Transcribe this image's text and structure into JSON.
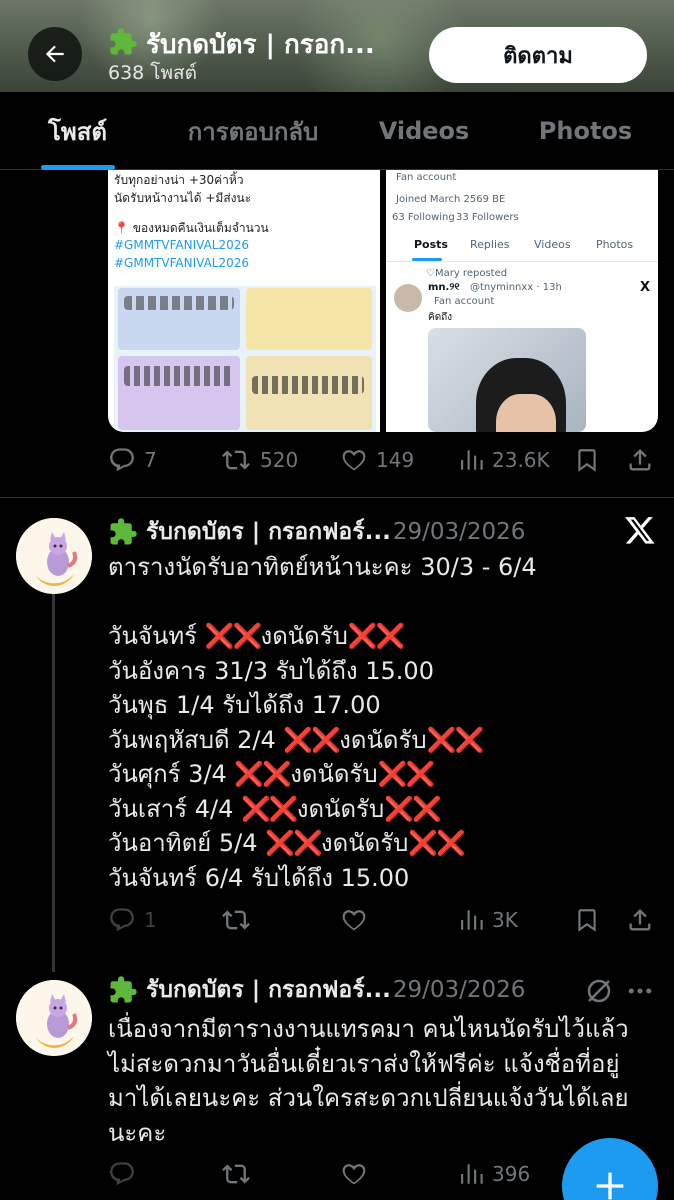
{
  "header": {
    "title": "รับกดบัตร | กรอก...",
    "post_count": "638 โพสต์",
    "follow_label": "ติดตาม",
    "icons": [
      "back-arrow-icon",
      "puzzle-icon"
    ]
  },
  "tabs": [
    {
      "label": "โพสต์",
      "active": true
    },
    {
      "label": "การตอบกลับ",
      "active": false
    },
    {
      "label": "Videos",
      "active": false
    },
    {
      "label": "Photos",
      "active": false
    }
  ],
  "post1": {
    "media1_lines": [
      "รับทุกอย่างน่า +30ค่าหิ้ว",
      "นัดรับหน้างานได้ +มีส่งนะ",
      "📍 ของหมดคืนเงินเต็มจำนวน"
    ],
    "media1_tags": [
      "#GMMTVFANIVAL2026",
      "#GMMTVFANIVAL2026"
    ],
    "media2": {
      "fan_account": "Fan account",
      "joined": "Joined March 2569 BE",
      "following": "63 Following",
      "followers": "33 Followers",
      "tabs": [
        "Posts",
        "Replies",
        "Videos",
        "Photos"
      ],
      "reposted": "♡Mary reposted",
      "name": "mn.୨୧",
      "handle": "@tnyminnxx · 13h",
      "fan_account2": "Fan account",
      "text": "คิดถึง"
    },
    "stats": {
      "replies": "7",
      "reposts": "520",
      "likes": "149",
      "views": "23.6K"
    }
  },
  "post2": {
    "name": "รับกดบัตร | กรอกฟอร์...",
    "date": "29/03/2026",
    "lines": [
      {
        "text": "ตารางนัดรับอาทิตย์หน้านะคะ 30/3 - 6/4",
        "pre": "",
        "post": ""
      },
      {
        "text": "",
        "gap": true
      },
      {
        "pre": "วันจันทร์ ",
        "xx1": "❌❌",
        "mid": "งดนัดรับ",
        "xx2": "❌❌"
      },
      {
        "text": "วันอังคาร 31/3 รับได้ถึง 15.00"
      },
      {
        "text": "วันพุธ 1/4 รับได้ถึง 17.00"
      },
      {
        "pre": "วันพฤหัสบดี 2/4 ",
        "xx1": "❌❌",
        "mid": "งดนัดรับ",
        "xx2": "❌❌"
      },
      {
        "pre": "วันศุกร์ 3/4 ",
        "xx1": "❌❌",
        "mid": "งดนัดรับ",
        "xx2": "❌❌"
      },
      {
        "pre": "วันเสาร์ 4/4 ",
        "xx1": "❌❌",
        "mid": "งดนัดรับ",
        "xx2": "❌❌"
      },
      {
        "pre": "วันอาทิตย์ 5/4 ",
        "xx1": "❌❌",
        "mid": "งดนัดรับ",
        "xx2": "❌❌"
      },
      {
        "text": "วันจันทร์ 6/4 รับได้ถึง 15.00"
      }
    ],
    "stats": {
      "replies": "1",
      "reposts": "",
      "likes": "",
      "views": "3K"
    }
  },
  "post3": {
    "name": "รับกดบัตร | กรอกฟอร์...",
    "date": "29/03/2026",
    "lines": [
      "เนื่องจากมีตารางงานแทรคมา คนไหนนัดรับไว้แล้ว",
      "ไม่สะดวกมาวันอื่นเดี๋ยวเราส่งให้ฟรีค่ะ แจ้งชื่อที่อยู่",
      "มาได้เลยนะคะ ส่วนใครสะดวกเปลี่ยนแจ้งวันได้เลย",
      "นะคะ"
    ],
    "stats": {
      "views": "396"
    }
  },
  "colors": {
    "accent": "#1d9bf0",
    "muted": "#71767b",
    "red_x": "#f4212e",
    "background": "#000000"
  }
}
